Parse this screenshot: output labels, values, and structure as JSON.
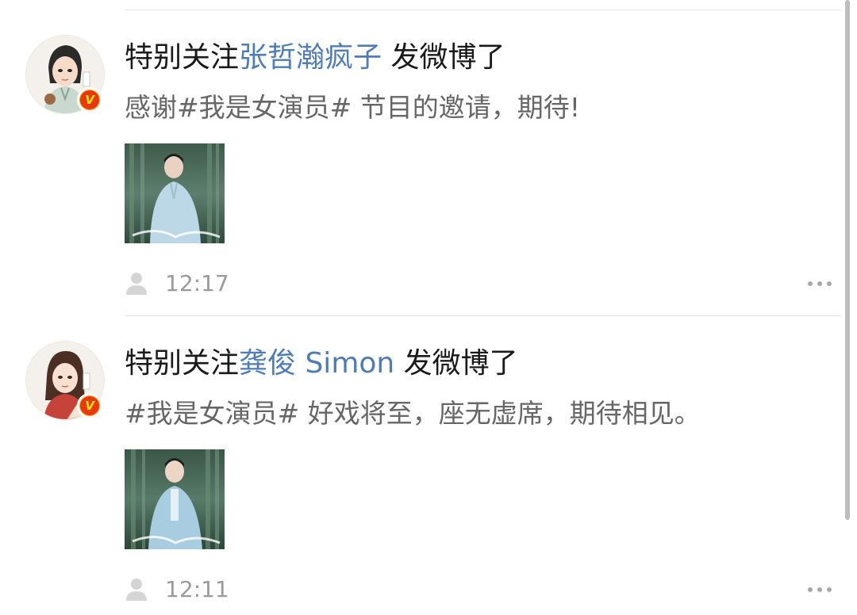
{
  "posts": [
    {
      "prefix": "特别关注",
      "username": "张哲瀚疯子",
      "suffix": " 发微博了",
      "text": "感谢#我是女演员# 节目的邀请，期待!",
      "time": "12:17",
      "avatar_icon": "avatar-image",
      "verified_badge": "V"
    },
    {
      "prefix": "特别关注",
      "username": "龚俊 Simon",
      "suffix": " 发微博了",
      "text": "#我是女演员# 好戏将至，座无虚席，期待相见。",
      "time": "12:11",
      "avatar_icon": "avatar-image",
      "verified_badge": "V"
    }
  ],
  "colors": {
    "link": "#4e7cb3",
    "body_text": "#666666",
    "meta_text": "#9a9a9a",
    "badge_orange": "#f5a623",
    "badge_red": "#e8380d"
  }
}
